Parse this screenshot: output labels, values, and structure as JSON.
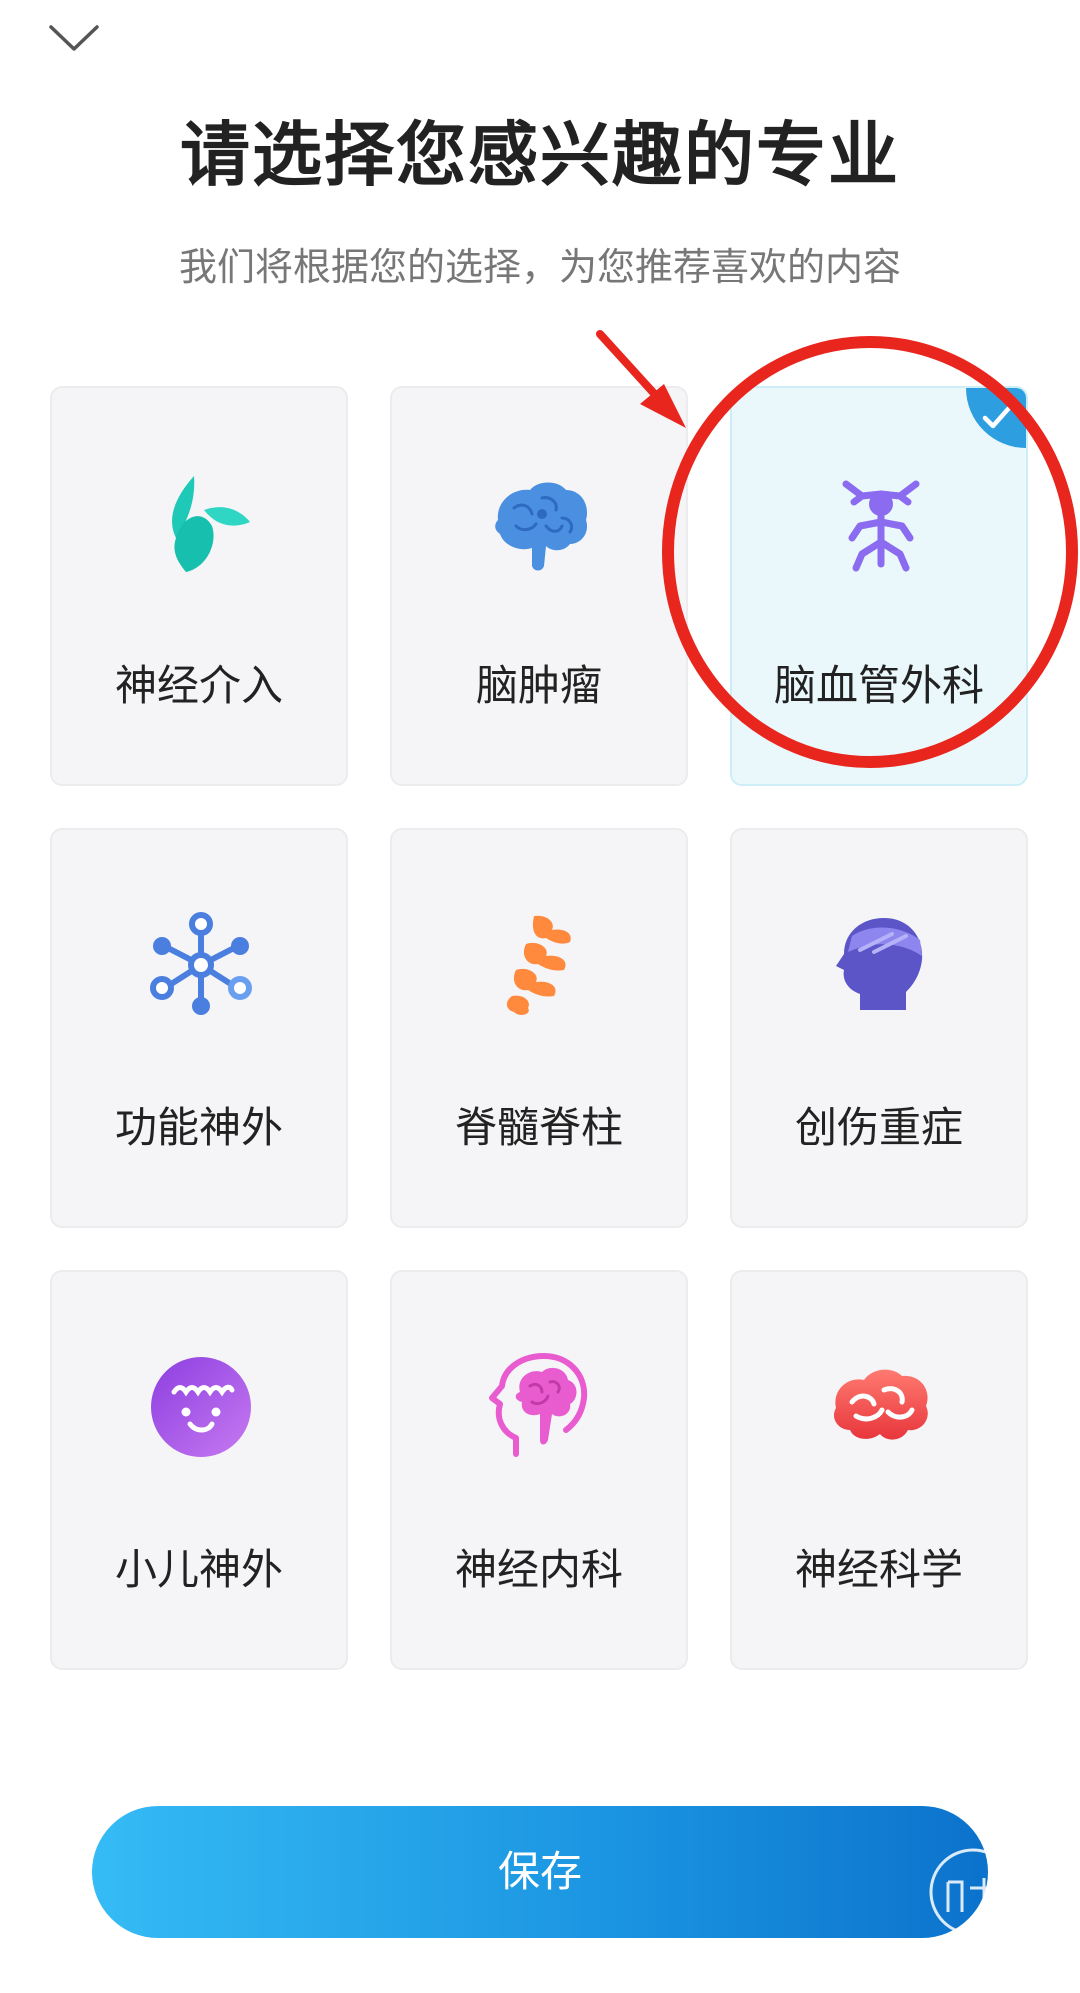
{
  "header": {
    "collapse_icon": "chevron-down-icon",
    "title": "请选择您感兴趣的专业",
    "subtitle": "我们将根据您的选择，为您推荐喜欢的内容"
  },
  "specialties": [
    {
      "label": "神经介入",
      "icon": "leaf-icon",
      "color": "#1fc9b8",
      "selected": false
    },
    {
      "label": "脑肿瘤",
      "icon": "brain-icon",
      "color": "#4a8fe0",
      "selected": false
    },
    {
      "label": "脑血管外科",
      "icon": "vessel-tree-icon",
      "color": "#8b6cf0",
      "selected": true
    },
    {
      "label": "功能神外",
      "icon": "network-nodes-icon",
      "color": "#4a7fe0",
      "selected": false
    },
    {
      "label": "脊髓脊柱",
      "icon": "spine-icon",
      "color": "#ff8a3d",
      "selected": false
    },
    {
      "label": "创伤重症",
      "icon": "head-bandage-icon",
      "color": "#6a63d8",
      "selected": false
    },
    {
      "label": "小儿神外",
      "icon": "child-face-icon",
      "color": "#a256e6",
      "selected": false
    },
    {
      "label": "神经内科",
      "icon": "head-brain-icon",
      "color": "#e85cd0",
      "selected": false
    },
    {
      "label": "神经科学",
      "icon": "brain-icon",
      "color": "#f05a5a",
      "selected": false
    }
  ],
  "save_button": {
    "label": "保存"
  },
  "colors": {
    "selected_card_bg": "#eaf8fc",
    "check_badge": "#2d9fe0",
    "annotation_red": "#e8261e",
    "button_gradient_start": "#35bbf5",
    "button_gradient_end": "#0c72cc"
  }
}
